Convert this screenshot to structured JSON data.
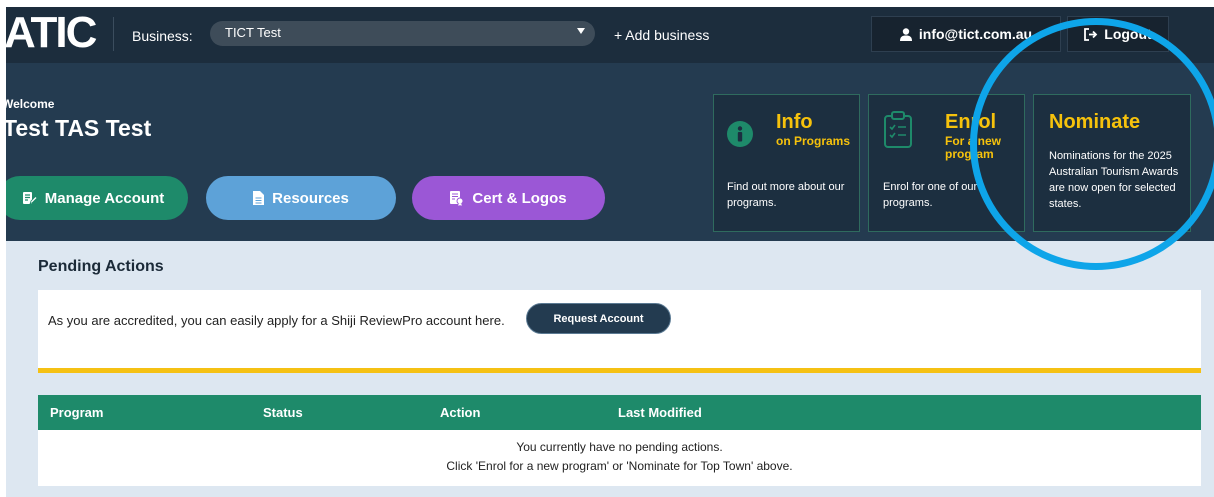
{
  "topbar": {
    "logo": "ATIC",
    "business_label": "Business:",
    "business_value": "TICT Test",
    "add_business": "+ Add business",
    "user_email": "info@tict.com.au",
    "logout": "Logout"
  },
  "hero": {
    "welcome": "Welcome",
    "user_name": "Test TAS Test",
    "buttons": {
      "manage": "Manage Account",
      "resources": "Resources",
      "cert": "Cert & Logos"
    }
  },
  "cards": {
    "info": {
      "title": "Info",
      "subtitle": "on Programs",
      "desc": "Find out more about our programs."
    },
    "enrol": {
      "title": "Enrol",
      "subtitle": "For a new program",
      "desc": "Enrol for one of our programs."
    },
    "nominate": {
      "title": "Nominate",
      "desc": "Nominations for the 2025 Australian Tourism Awards are now open for selected states."
    }
  },
  "pending": {
    "title": "Pending Actions",
    "notice_text": "As you are accredited, you can easily apply for a Shiji ReviewPro account here.",
    "request_button": "Request Account"
  },
  "table": {
    "columns": [
      "Program",
      "Status",
      "Action",
      "Last Modified"
    ],
    "empty_line1": "You currently have no pending actions.",
    "empty_line2": "Click 'Enrol for a new program' or 'Nominate for Top Town' above."
  },
  "colors": {
    "topbar": "#1c2d3d",
    "hero": "#243b50",
    "accent_yellow": "#f6c20c",
    "green": "#1e8a6a",
    "blue": "#5da2d8",
    "purple": "#9b57d6",
    "highlight_ring": "#0ea5e9"
  }
}
